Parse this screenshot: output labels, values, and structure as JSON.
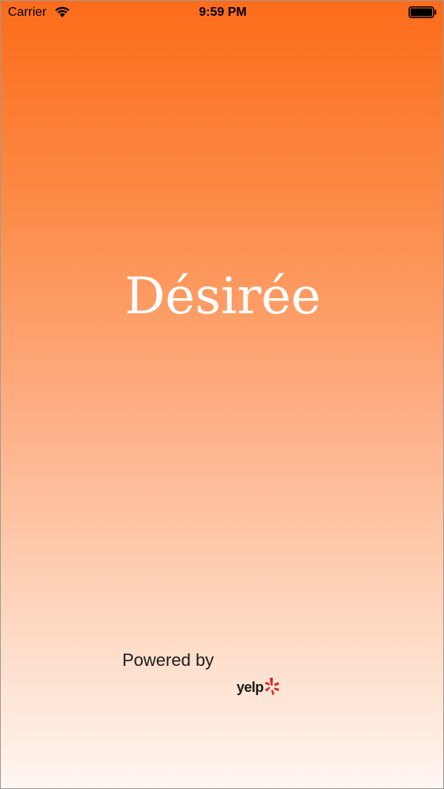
{
  "status_bar": {
    "carrier": "Carrier",
    "time": "9:59 PM",
    "wifi_icon": "wifi-icon",
    "battery_icon": "battery-icon"
  },
  "splash": {
    "title": "Désirée",
    "powered_by": "Powered by",
    "yelp_logo_text": "yelp",
    "yelp_burst_icon": "yelp-burst-icon"
  },
  "colors": {
    "gradient_top": "#fc6c1a",
    "gradient_bottom": "#fff6f1",
    "title_color": "#ffffff",
    "yelp_red": "#d32323"
  }
}
